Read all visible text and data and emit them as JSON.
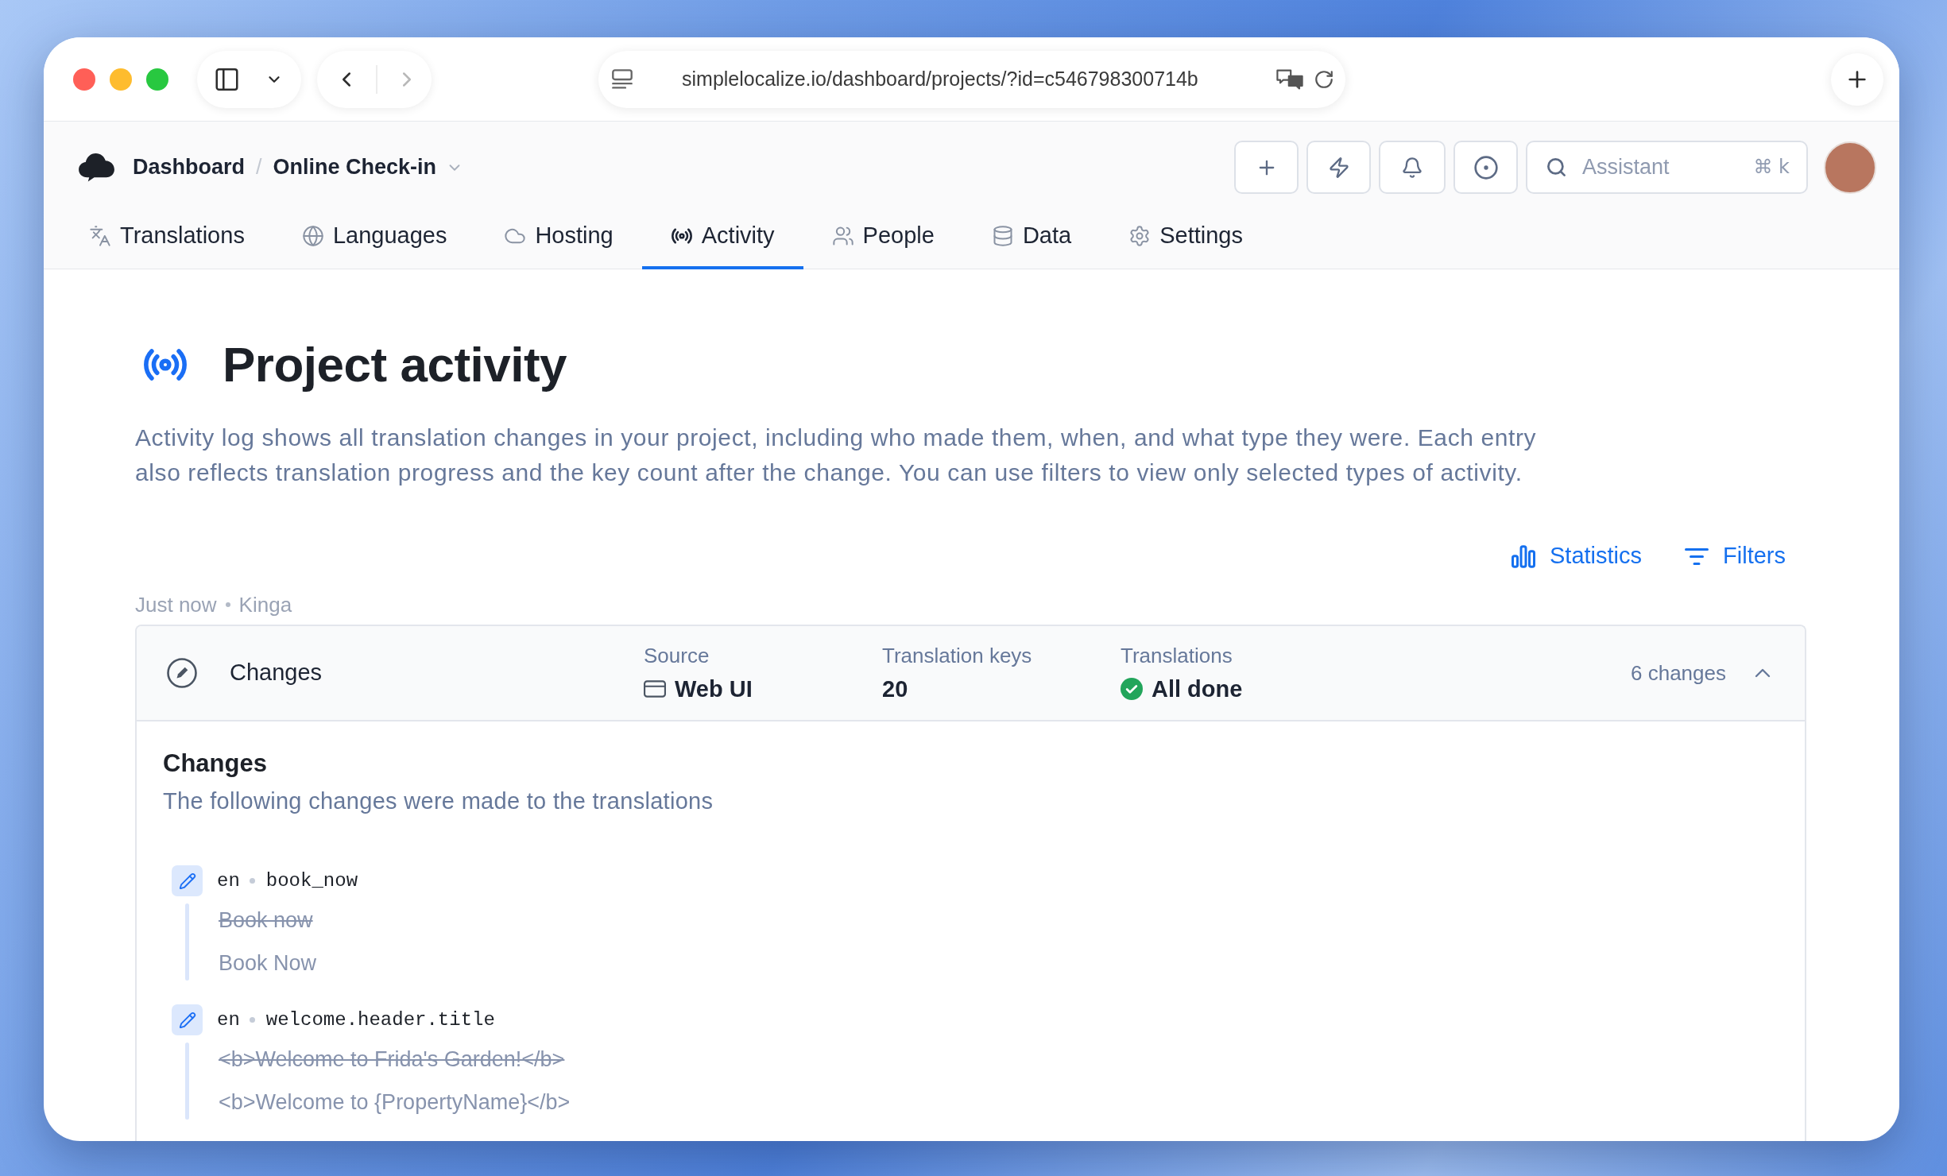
{
  "browser": {
    "url": "simplelocalize.io/dashboard/projects/?id=c546798300714b",
    "back": {
      "disabled": false
    },
    "forward": {
      "disabled": true
    }
  },
  "header": {
    "breadcrumb": {
      "items": [
        "Dashboard",
        "Online Check-in"
      ],
      "separator": "/"
    },
    "search": {
      "placeholder": "Assistant",
      "shortcut": "⌘ k"
    }
  },
  "tabs": [
    {
      "label": "Translations",
      "kind": "translate",
      "selected": false
    },
    {
      "label": "Languages",
      "kind": "globe",
      "selected": false
    },
    {
      "label": "Hosting",
      "kind": "cloud",
      "selected": false
    },
    {
      "label": "Activity",
      "kind": "broadcast",
      "selected": true
    },
    {
      "label": "People",
      "kind": "people",
      "selected": false
    },
    {
      "label": "Data",
      "kind": "database",
      "selected": false
    },
    {
      "label": "Settings",
      "kind": "gear",
      "selected": false
    }
  ],
  "page": {
    "title": "Project activity",
    "description": "Activity log shows all translation changes in your project, including who made them, when, and what type they were. Each entry also reflects translation progress and the key count after the change. You can use filters to view only selected types of activity.",
    "actions": [
      {
        "label": "Statistics",
        "kind": "statistics"
      },
      {
        "label": "Filters",
        "kind": "filters"
      }
    ]
  },
  "activity": [
    {
      "time": "Just now",
      "author": "Kinga",
      "title": "Changes",
      "fields": [
        {
          "label": "Source",
          "value": "Web UI",
          "kind": "source"
        },
        {
          "label": "Translation keys",
          "value": "20",
          "kind": "count"
        },
        {
          "label": "Translations",
          "value": "All done",
          "kind": "status"
        }
      ],
      "count": "6 changes",
      "expanded": true,
      "details": {
        "title": "Changes",
        "subtitle": "The following changes were made to the translations",
        "changes": [
          {
            "language": "en",
            "key": "book_now",
            "old": "Book now",
            "new": "Book Now"
          },
          {
            "language": "en",
            "key": "welcome.header.title",
            "old": "<b>Welcome to Frida's Garden!</b>",
            "new": "<b>Welcome to {PropertyName}</b>"
          }
        ]
      }
    }
  ]
}
